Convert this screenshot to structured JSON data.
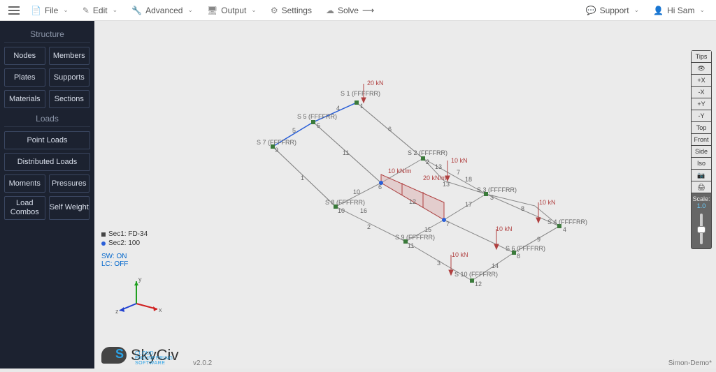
{
  "topmenu": {
    "file": "File",
    "edit": "Edit",
    "advanced": "Advanced",
    "output": "Output",
    "settings": "Settings",
    "solve": "Solve",
    "support": "Support",
    "user": "Hi Sam"
  },
  "sidebar": {
    "structure_title": "Structure",
    "nodes": "Nodes",
    "members": "Members",
    "plates": "Plates",
    "supports": "Supports",
    "materials": "Materials",
    "sections": "Sections",
    "loads_title": "Loads",
    "point_loads": "Point Loads",
    "distributed_loads": "Distributed Loads",
    "moments": "Moments",
    "pressures": "Pressures",
    "load_combos": "Load\nCombos",
    "self_weight": "Self\nWeight"
  },
  "canvas": {
    "legend_sec1": "Sec1: FD-34",
    "legend_sec2": "Sec2: 100",
    "sw": "SW: ON",
    "lc": "LC: OFF",
    "axis_x": "x",
    "axis_y": "y",
    "axis_z": "z",
    "supports": [
      {
        "label": "S 1 (FFFFRR)",
        "node": "1"
      },
      {
        "label": "S 5 (FFFFRR)",
        "node": "5"
      },
      {
        "label": "S 7 (FFFFRR)",
        "node": "9"
      },
      {
        "label": "S 2 (FFFFRR)",
        "node": "2"
      },
      {
        "label": "S 3 (FFFFRR)",
        "node": "3"
      },
      {
        "label": "S 4 (FFFFRR)",
        "node": "4"
      },
      {
        "label": "S 8 (FFFFRR)",
        "node": "10"
      },
      {
        "label": "S 9 (FFFFRR)",
        "node": "11"
      },
      {
        "label": "S 6 (FFFFRR)",
        "node": "8"
      },
      {
        "label": "S 10 (FFFFRR)",
        "node": "12"
      }
    ],
    "loads": {
      "pt20": "20 kN",
      "pt10a": "10 kN",
      "pt10b": "10 kN",
      "pt10c": "10 kN",
      "pt10d": "10 kN",
      "dl10": "10 kN/m",
      "dl20": "20 kN/m"
    },
    "member_ids": [
      "1",
      "2",
      "3",
      "4",
      "5",
      "6",
      "7",
      "8",
      "9",
      "10",
      "11",
      "12",
      "13",
      "14",
      "15",
      "16",
      "17",
      "18"
    ],
    "node_ids": [
      "1",
      "2",
      "3",
      "4",
      "5",
      "6",
      "7",
      "8",
      "9",
      "10",
      "11",
      "12",
      "13"
    ]
  },
  "viewbar": {
    "tips": "Tips",
    "eye": "👁",
    "px": "+X",
    "mx": "-X",
    "py": "+Y",
    "my": "-Y",
    "top": "Top",
    "front": "Front",
    "side": "Side",
    "iso": "Iso",
    "camera": "📷",
    "print": "🖨",
    "scale_label": "Scale:",
    "scale_value": "1.0"
  },
  "logo": {
    "name": "SkyCiv",
    "tag": "CLOUD ENGINEERING SOFTWARE"
  },
  "status": {
    "version": "v2.0.2",
    "project": "Simon-Demo*"
  }
}
